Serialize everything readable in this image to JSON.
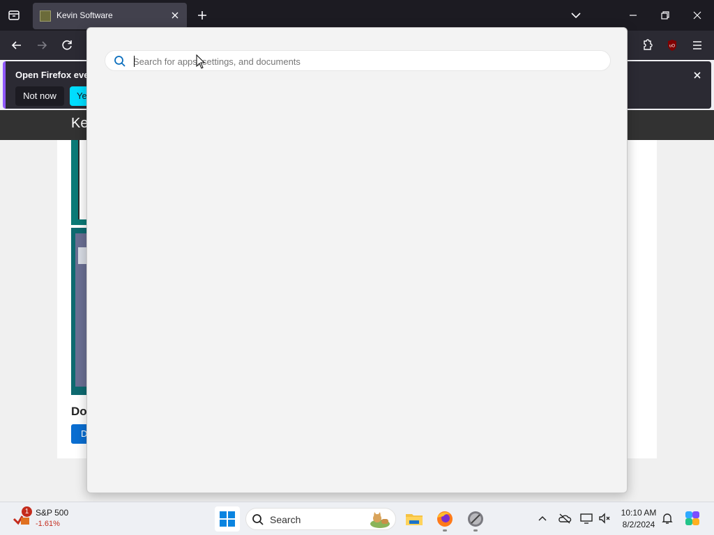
{
  "browser": {
    "tab": {
      "title": "Kevin Software"
    },
    "colors": {
      "tabstrip": "#1c1b22",
      "navbar": "#2b2a33",
      "accent": "#00ddff"
    }
  },
  "notification": {
    "message": "Open Firefox ever",
    "not_now_label": "Not now",
    "yes_label": "Yes"
  },
  "site": {
    "title_partial": "Ke",
    "download_heading_partial": "Do",
    "download_button_partial": "D"
  },
  "search_flyout": {
    "placeholder": "Search for apps, settings, and documents",
    "value": ""
  },
  "taskbar": {
    "stock": {
      "name": "S&P 500",
      "change": "-1.61%",
      "badge": "1"
    },
    "search_label": "Search",
    "clock": {
      "time": "10:10 AM",
      "date": "8/2/2024"
    },
    "icons": [
      "windows-start-icon",
      "search-icon",
      "file-explorer-icon",
      "firefox-icon",
      "app-icon",
      "chevron-up-icon",
      "onedrive-icon",
      "display-icon",
      "volume-muted-icon",
      "bell-icon",
      "copilot-icon"
    ]
  }
}
